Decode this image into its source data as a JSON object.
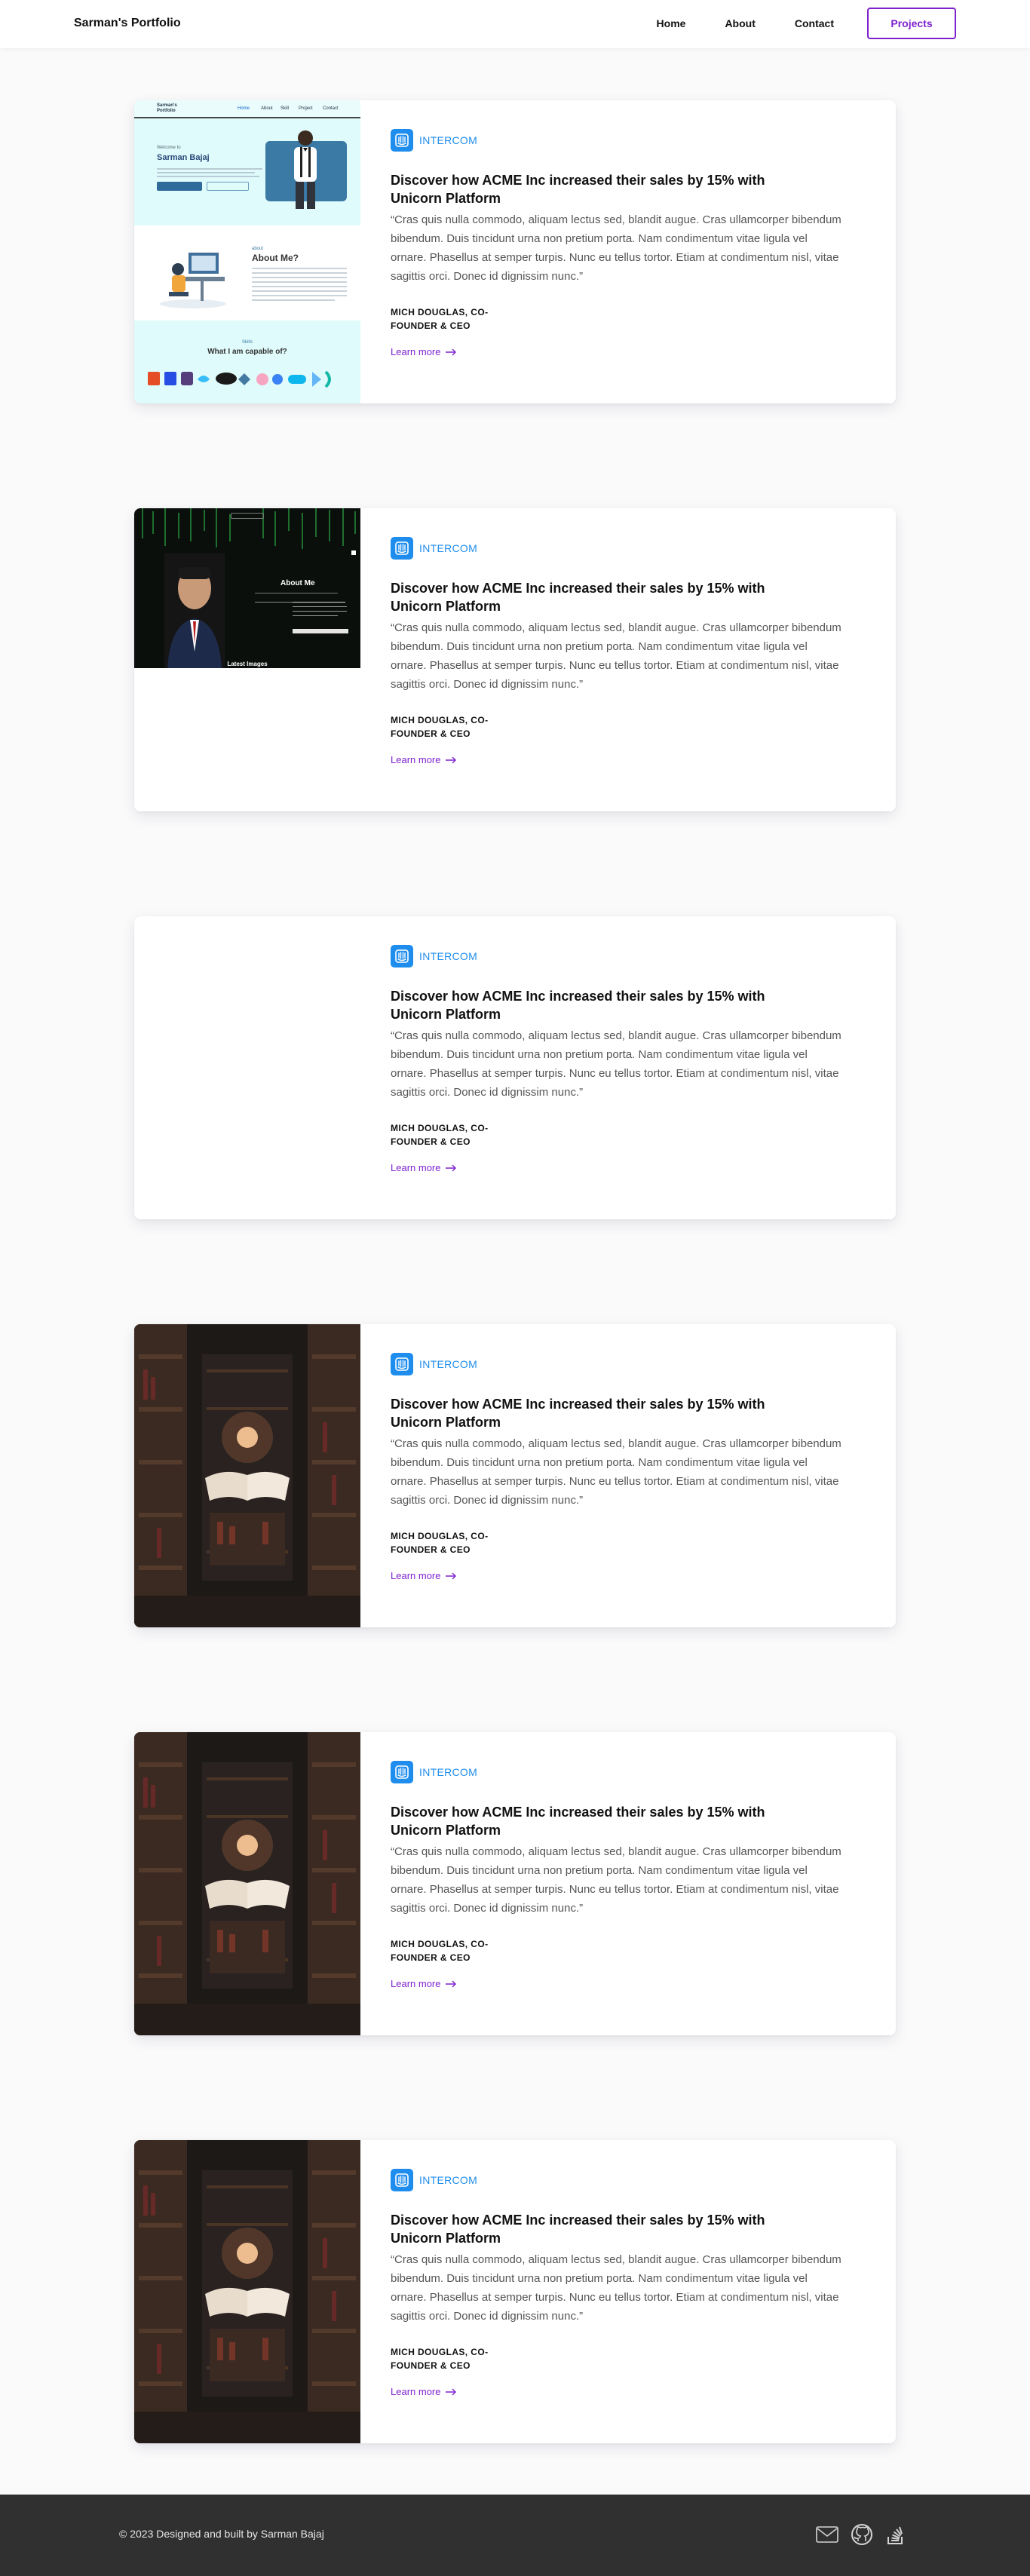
{
  "header": {
    "brand": "Sarman's Portfolio",
    "nav": [
      {
        "label": "Home"
      },
      {
        "label": "About"
      },
      {
        "label": "Contact"
      }
    ],
    "cta": "Projects"
  },
  "projects": [
    {
      "company": "INTERCOM",
      "title": "Discover how ACME Inc increased their sales by 15% with Unicorn Platform",
      "quote": "“Cras quis nulla commodo, aliquam lectus sed, blandit augue. Cras ullamcorper bibendum bibendum. Duis tincidunt urna non pretium porta. Nam condimentum vitae ligula vel ornare. Phasellus at semper turpis. Nunc eu tellus tortor. Etiam at condimentum nisl, vitae sagittis orci. Donec id dignissim nunc.”",
      "author": "MICH DOUGLAS, CO-FOUNDER & CEO",
      "link": "Learn more",
      "media": {
        "nav": [
          "Home",
          "About",
          "Skill",
          "Project",
          "Contact"
        ],
        "brand": "Sarman's Portfolio",
        "greeting": "Welcome to",
        "name": "Sarman Bajaj",
        "about_kicker": "about",
        "about_title": "About Me?",
        "skills_kicker": "Skills",
        "skills_title": "What I am capable of?"
      }
    },
    {
      "company": "INTERCOM",
      "title": "Discover how ACME Inc increased their sales by 15% with Unicorn Platform",
      "quote": "“Cras quis nulla commodo, aliquam lectus sed, blandit augue. Cras ullamcorper bibendum bibendum. Duis tincidunt urna non pretium porta. Nam condimentum vitae ligula vel ornare. Phasellus at semper turpis. Nunc eu tellus tortor. Etiam at condimentum nisl, vitae sagittis orci. Donec id dignissim nunc.”",
      "author": "MICH DOUGLAS, CO-FOUNDER & CEO",
      "link": "Learn more",
      "media": {
        "about_title": "About Me",
        "latest_title": "Latest Images"
      }
    },
    {
      "company": "INTERCOM",
      "title": "Discover how ACME Inc increased their sales by 15% with Unicorn Platform",
      "quote": "“Cras quis nulla commodo, aliquam lectus sed, blandit augue. Cras ullamcorper bibendum bibendum. Duis tincidunt urna non pretium porta. Nam condimentum vitae ligula vel ornare. Phasellus at semper turpis. Nunc eu tellus tortor. Etiam at condimentum nisl, vitae sagittis orci. Donec id dignissim nunc.”",
      "author": "MICH DOUGLAS, CO-FOUNDER & CEO",
      "link": "Learn more"
    },
    {
      "company": "INTERCOM",
      "title": "Discover how ACME Inc increased their sales by 15% with Unicorn Platform",
      "quote": "“Cras quis nulla commodo, aliquam lectus sed, blandit augue. Cras ullamcorper bibendum bibendum. Duis tincidunt urna non pretium porta. Nam condimentum vitae ligula vel ornare. Phasellus at semper turpis. Nunc eu tellus tortor. Etiam at condimentum nisl, vitae sagittis orci. Donec id dignissim nunc.”",
      "author": "MICH DOUGLAS, CO-FOUNDER & CEO",
      "link": "Learn more"
    },
    {
      "company": "INTERCOM",
      "title": "Discover how ACME Inc increased their sales by 15% with Unicorn Platform",
      "quote": "“Cras quis nulla commodo, aliquam lectus sed, blandit augue. Cras ullamcorper bibendum bibendum. Duis tincidunt urna non pretium porta. Nam condimentum vitae ligula vel ornare. Phasellus at semper turpis. Nunc eu tellus tortor. Etiam at condimentum nisl, vitae sagittis orci. Donec id dignissim nunc.”",
      "author": "MICH DOUGLAS, CO-FOUNDER & CEO",
      "link": "Learn more"
    },
    {
      "company": "INTERCOM",
      "title": "Discover how ACME Inc increased their sales by 15% with Unicorn Platform",
      "quote": "“Cras quis nulla commodo, aliquam lectus sed, blandit augue. Cras ullamcorper bibendum bibendum. Duis tincidunt urna non pretium porta. Nam condimentum vitae ligula vel ornare. Phasellus at semper turpis. Nunc eu tellus tortor. Etiam at condimentum nisl, vitae sagittis orci. Donec id dignissim nunc.”",
      "author": "MICH DOUGLAS, CO-FOUNDER & CEO",
      "link": "Learn more"
    }
  ],
  "footer": {
    "copyright": "© 2023 Designed and built by Sarman Bajaj",
    "icons": [
      "mail-icon",
      "github-icon",
      "stack-overflow-icon"
    ]
  },
  "colors": {
    "accent": "#7e22ce",
    "intercom_blue": "#1f8ded",
    "footer_bg": "#303030"
  }
}
